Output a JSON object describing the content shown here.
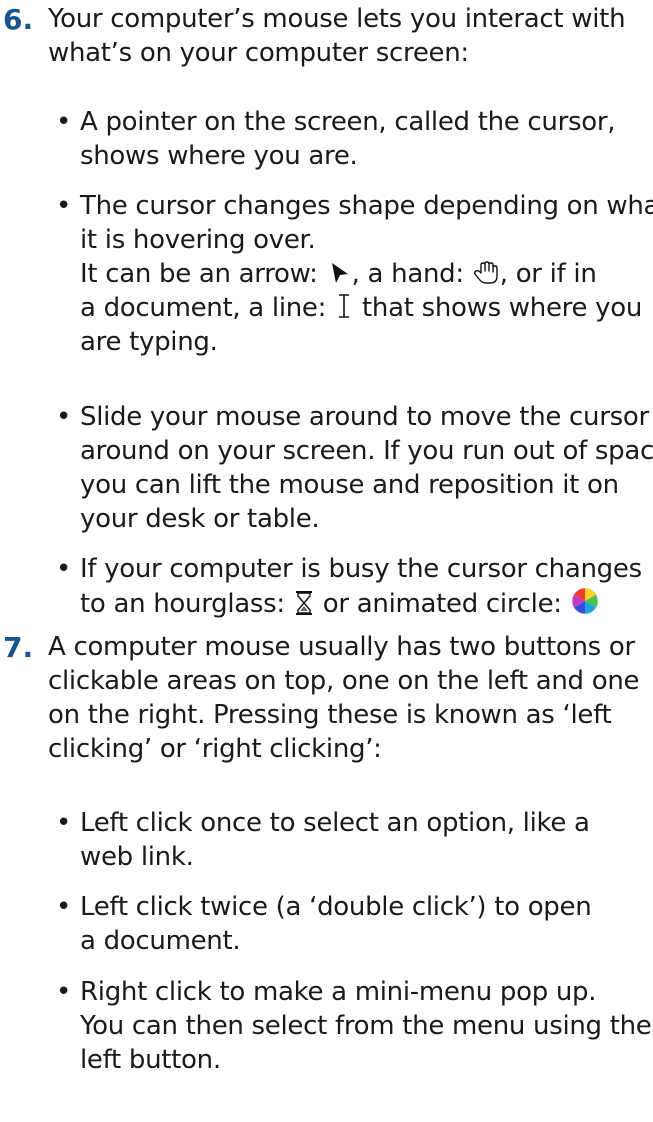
{
  "steps": [
    {
      "number": "6.",
      "text_lines": [
        "Your computer’s mouse lets you interact with",
        "what’s on your computer screen:"
      ],
      "bullets": [
        {
          "lines": [
            "A pointer on the screen, called the cursor,",
            "shows where you are."
          ]
        },
        {
          "lines": [
            "The cursor changes shape depending on what",
            "it is hovering over."
          ]
        },
        {
          "lines": [
            "Slide your mouse around to move the cursor",
            "around on your screen. If you run out of space",
            "you can lift the mouse and reposition it on",
            "your desk or table."
          ]
        },
        {
          "lines": [
            "If your computer is busy the cursor changes"
          ]
        }
      ],
      "cursor_shapes": {
        "arrow_prefix": "It can be an arrow:",
        "hand_prefix": ", a hand:",
        "line_prefix": ", or if in",
        "document_prefix": "a document, a line:",
        "line_suffix": "that shows where you",
        "end_line": "are typing."
      },
      "busy": {
        "prefix": "to an hourglass:",
        "middle": "or animated circle:"
      }
    },
    {
      "number": "7.",
      "text_lines": [
        "A computer mouse usually has two buttons or",
        "clickable areas on top, one on the left and one",
        "on the right. Pressing these is known as ‘left",
        "clicking’ or ‘right clicking’:"
      ],
      "bullets": [
        {
          "lines": [
            "Left click once to select an option, like a",
            "web link."
          ]
        },
        {
          "lines": [
            "Left click twice (a ‘double click’) to  open",
            "a document."
          ]
        },
        {
          "lines": [
            "Right click to make a mini-menu pop up.",
            "You can then select from the menu using the",
            "left button."
          ]
        }
      ]
    }
  ],
  "icons": [
    "arrow-cursor-icon",
    "hand-cursor-icon",
    "text-cursor-icon",
    "hourglass-icon",
    "spinning-wheel-icon"
  ],
  "colors": {
    "step_number": "#17548f",
    "text": "#1a1a1a",
    "background": "#ffffff"
  }
}
